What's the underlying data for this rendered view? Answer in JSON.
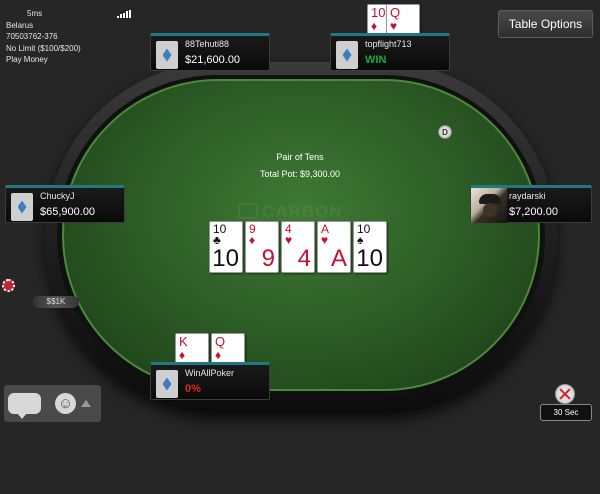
{
  "info": {
    "ping": "5ms",
    "country": "Belarus",
    "table_id": "70503762-376",
    "game": "No Limit ($100/$200)",
    "money": "Play Money"
  },
  "toolbar": {
    "table_options": "Table Options"
  },
  "watermark": "CARBON",
  "pot": {
    "hand_description": "Pair of Tens",
    "total_pot": "Total Pot: $9,300.00"
  },
  "dealer_button": "D",
  "board_cards": [
    {
      "rank": "10",
      "suit": "♣",
      "color": "black"
    },
    {
      "rank": "9",
      "suit": "♦",
      "color": "red"
    },
    {
      "rank": "4",
      "suit": "♥",
      "color": "red"
    },
    {
      "rank": "A",
      "suit": "♥",
      "color": "red"
    },
    {
      "rank": "10",
      "suit": "♠",
      "color": "black"
    }
  ],
  "seats": {
    "top_left": {
      "name": "88Tehuti88",
      "stack": "$21,600.00"
    },
    "top_right": {
      "name": "topflight713",
      "stack": "WIN",
      "cards": [
        {
          "rank": "10",
          "suit": "♦",
          "color": "red"
        },
        {
          "rank": "Q",
          "suit": "♥",
          "color": "red"
        }
      ]
    },
    "left": {
      "name": "ChuckyJ",
      "stack": "$65,900.00"
    },
    "right": {
      "name": "raydarski",
      "stack": "$7,200.00"
    },
    "hero": {
      "name": "WinAllPoker",
      "stack": "0%",
      "cards": [
        {
          "rank": "K",
          "suit": "♦",
          "color": "red"
        },
        {
          "rank": "Q",
          "suit": "♦",
          "color": "red"
        }
      ]
    }
  },
  "bet_label": "$$1K",
  "timer": {
    "label": "30 Sec"
  },
  "icons": [
    "signal-icon",
    "dealer-button",
    "chat-icon",
    "smiley-icon",
    "timer-icon"
  ],
  "colors": {
    "felt": "#2e5f27",
    "seat_accent": "#21787e",
    "win": "#1aa83a",
    "loss": "#e2261f"
  }
}
